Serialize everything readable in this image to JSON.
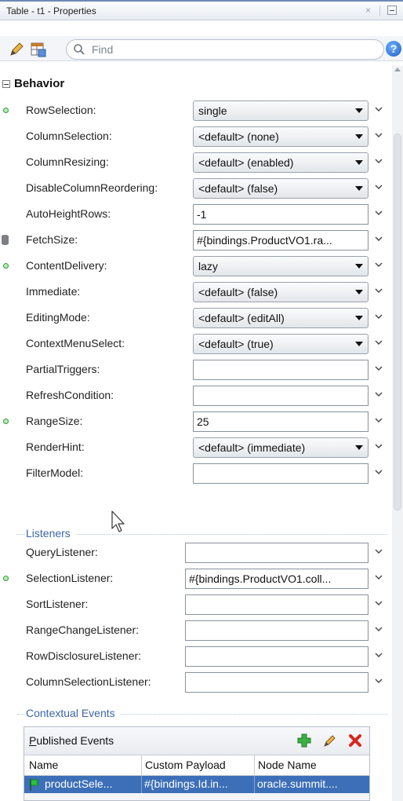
{
  "window": {
    "title": "Table - t1 - Properties",
    "close_glyph": "×"
  },
  "toolbar": {
    "find_placeholder": "Find",
    "help_glyph": "?"
  },
  "behavior": {
    "section_title": "Behavior",
    "rows": [
      {
        "label": "RowSelection:",
        "value": "single",
        "kind": "combo",
        "marker": "dot"
      },
      {
        "label": "ColumnSelection:",
        "value": "<default> (none)",
        "kind": "combo",
        "marker": ""
      },
      {
        "label": "ColumnResizing:",
        "value": "<default> (enabled)",
        "kind": "combo",
        "marker": ""
      },
      {
        "label": "DisableColumnReordering:",
        "value": "<default> (false)",
        "kind": "combo",
        "marker": ""
      },
      {
        "label": "AutoHeightRows:",
        "value": "-1",
        "kind": "text",
        "marker": ""
      },
      {
        "label": "FetchSize:",
        "value": "#{bindings.ProductVO1.ra...",
        "kind": "text",
        "marker": "db"
      },
      {
        "label": "ContentDelivery:",
        "value": "lazy",
        "kind": "combo",
        "marker": "dot"
      },
      {
        "label": "Immediate:",
        "value": "<default> (false)",
        "kind": "combo",
        "marker": ""
      },
      {
        "label": "EditingMode:",
        "value": "<default> (editAll)",
        "kind": "combo",
        "marker": ""
      },
      {
        "label": "ContextMenuSelect:",
        "value": "<default> (true)",
        "kind": "combo",
        "marker": ""
      },
      {
        "label": "PartialTriggers:",
        "value": "",
        "kind": "text",
        "marker": ""
      },
      {
        "label": "RefreshCondition:",
        "value": "",
        "kind": "text",
        "marker": ""
      },
      {
        "label": "RangeSize:",
        "value": "25",
        "kind": "text",
        "marker": "dot"
      },
      {
        "label": "RenderHint:",
        "value": "<default> (immediate)",
        "kind": "combo",
        "marker": ""
      },
      {
        "label": "FilterModel:",
        "value": "",
        "kind": "text",
        "marker": ""
      }
    ]
  },
  "listeners": {
    "title": "Listeners",
    "rows": [
      {
        "label": "QueryListener:",
        "value": "",
        "marker": ""
      },
      {
        "label": "SelectionListener:",
        "value": "#{bindings.ProductVO1.coll...",
        "marker": "dot"
      },
      {
        "label": "SortListener:",
        "value": "",
        "marker": ""
      },
      {
        "label": "RangeChangeListener:",
        "value": "",
        "marker": ""
      },
      {
        "label": "RowDisclosureListener:",
        "value": "",
        "marker": ""
      },
      {
        "label": "ColumnSelectionListener:",
        "value": "",
        "marker": ""
      }
    ]
  },
  "contextual_events": {
    "title": "Contextual Events",
    "published_events_label": "Published Events",
    "published_events_mnemonic": "P",
    "published_events_rest": "ublished Events",
    "columns": [
      "Name",
      "Custom Payload",
      "Node Name"
    ],
    "rows": [
      {
        "name": "productSele...",
        "payload": "#{bindings.Id.in...",
        "node": "oracle.summit...."
      }
    ]
  },
  "colors": {
    "accent": "#3d6fb8",
    "subsection_title": "#3b66a8",
    "marker_green": "#2f9a3b"
  },
  "icons": [
    "pencil-icon",
    "table-icon",
    "search-icon",
    "help-icon",
    "chevron-down-icon",
    "add-icon",
    "edit-icon",
    "delete-icon",
    "flag-icon",
    "database-icon",
    "mouse-cursor-icon"
  ]
}
